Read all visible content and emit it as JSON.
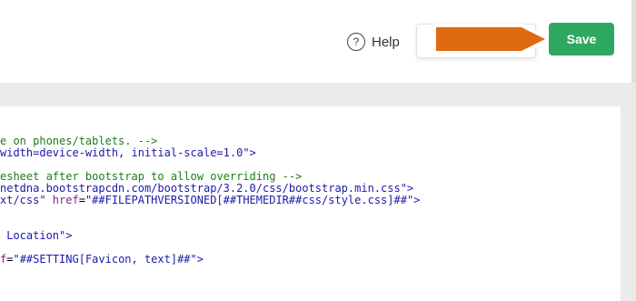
{
  "header": {
    "help_label": "Help",
    "help_icon": "question-circle-icon",
    "save_label": "Save",
    "colors": {
      "save": "#2ea860",
      "arrow": "#e06a12"
    }
  },
  "editor": {
    "lines": [
      {
        "segs": [
          {
            "t": "e on phones/tablets. -->",
            "c": "comment"
          }
        ]
      },
      {
        "segs": [
          {
            "t": "width=device-width, initial-scale=1.0",
            "c": "str"
          },
          {
            "t": "\">",
            "c": "str"
          }
        ]
      },
      {
        "segs": []
      },
      {
        "segs": [
          {
            "t": "esheet after bootstrap to allow overriding -->",
            "c": "comment"
          }
        ]
      },
      {
        "segs": [
          {
            "t": "netdna.bootstrapcdn.com/bootstrap/3.2.0/css/bootstrap.min.css",
            "c": "str"
          },
          {
            "t": "\">",
            "c": "str"
          }
        ]
      },
      {
        "segs": [
          {
            "t": "xt/css\" ",
            "c": "str"
          },
          {
            "t": "href",
            "c": "attr"
          },
          {
            "t": "=",
            "c": "plain"
          },
          {
            "t": "\"##FILEPATHVERSIONED[##THEMEDIR##css/style.css]##\"",
            "c": "str"
          },
          {
            "t": ">",
            "c": "str"
          }
        ]
      },
      {
        "segs": []
      },
      {
        "segs": []
      },
      {
        "segs": [
          {
            "t": " Location\"",
            "c": "str"
          },
          {
            "t": ">",
            "c": "str"
          }
        ]
      },
      {
        "segs": []
      },
      {
        "segs": [
          {
            "t": "f",
            "c": "attr"
          },
          {
            "t": "=",
            "c": "plain"
          },
          {
            "t": "\"##SETTING[Favicon, text]##\"",
            "c": "str"
          },
          {
            "t": ">",
            "c": "str"
          }
        ]
      }
    ]
  }
}
